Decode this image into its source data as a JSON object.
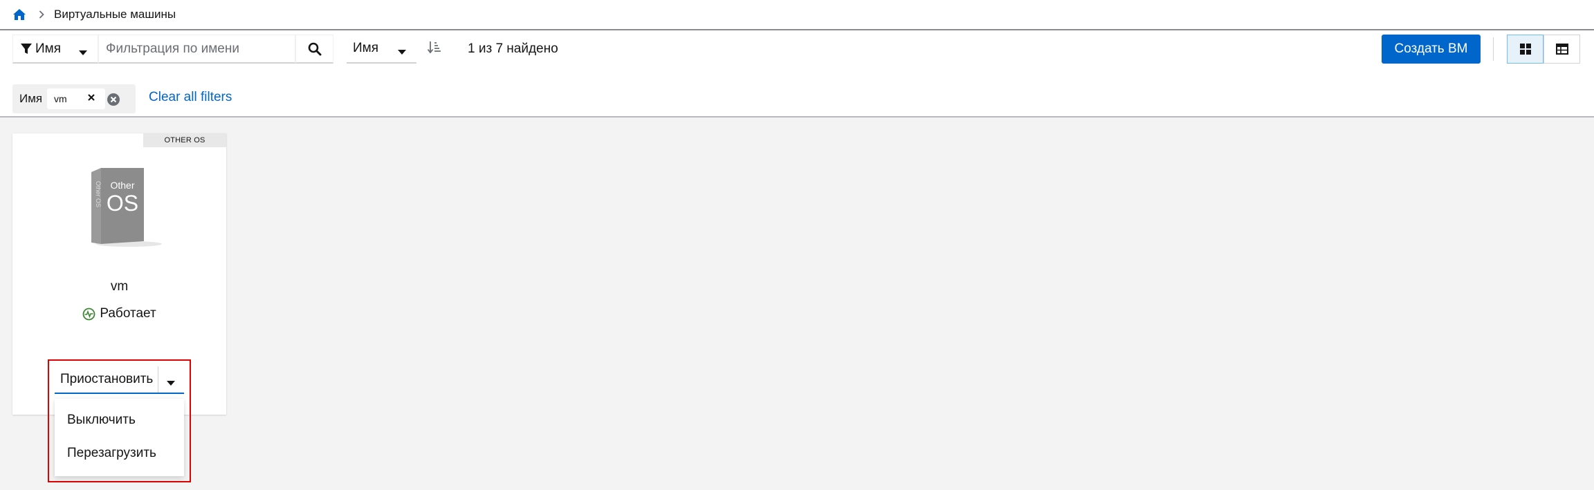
{
  "breadcrumb": {
    "home_icon": "home-icon",
    "current": "Виртуальные машины"
  },
  "toolbar": {
    "filter_type_label": "Имя",
    "search_placeholder": "Фильтрация по имени",
    "sort_label": "Имя",
    "result_count": "1 из 7 найдено",
    "create_label": "Создать ВМ",
    "view_modes": [
      "card-view",
      "table-view"
    ],
    "active_view": "card-view"
  },
  "filters": {
    "chip_category": "Имя",
    "chip_value": "vm",
    "clear_all_label": "Clear all filters"
  },
  "card": {
    "os_badge": "OTHER OS",
    "os_image_text_top": "Other",
    "os_image_text_big": "OS",
    "os_image_spine": "Other OS",
    "name": "vm",
    "status": "Работает",
    "status_color": "#3e8635"
  },
  "actions": {
    "primary": "Приостановить",
    "menu": [
      "Выключить",
      "Перезагрузить"
    ]
  },
  "colors": {
    "accent": "#0066cc",
    "highlight": "#e00000"
  }
}
